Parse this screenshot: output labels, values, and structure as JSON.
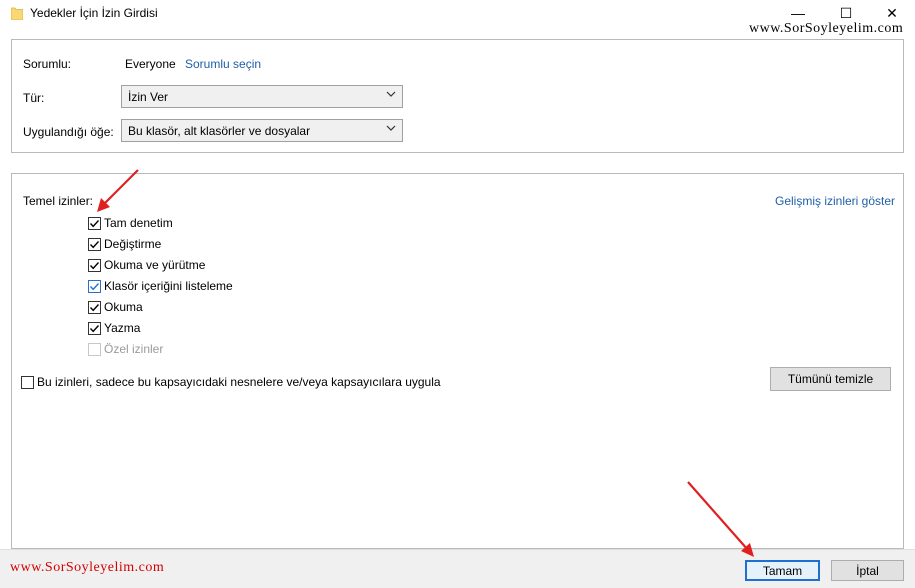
{
  "window": {
    "title": "Yedekler İçin İzin Girdisi",
    "controls": {
      "minimize": "—",
      "maximize": "☐",
      "close": "✕"
    }
  },
  "watermark": {
    "top": "www.SorSoyleyelim.com",
    "bottom": "www.SorSoyleyelim.com"
  },
  "principal": {
    "label": "Sorumlu:",
    "value": "Everyone",
    "select_link": "Sorumlu seçin"
  },
  "type": {
    "label": "Tür:",
    "value": "İzin Ver"
  },
  "applies_to": {
    "label": "Uygulandığı öğe:",
    "value": "Bu klasör, alt klasörler ve dosyalar"
  },
  "basic_permissions": {
    "label": "Temel izinler:",
    "show_advanced_link": "Gelişmiş izinleri göster",
    "items": [
      {
        "label": "Tam denetim",
        "checked": true,
        "disabled": false
      },
      {
        "label": "Değiştirme",
        "checked": true,
        "disabled": false
      },
      {
        "label": "Okuma ve yürütme",
        "checked": true,
        "disabled": false
      },
      {
        "label": "Klasör içeriğini listeleme",
        "checked": true,
        "disabled": false
      },
      {
        "label": "Okuma",
        "checked": true,
        "disabled": false
      },
      {
        "label": "Yazma",
        "checked": true,
        "disabled": false
      },
      {
        "label": "Özel izinler",
        "checked": false,
        "disabled": true
      }
    ],
    "apply_only_label": "Bu izinleri, sadece bu kapsayıcıdaki nesnelere ve/veya kapsayıcılara uygula",
    "apply_only_checked": false,
    "clear_all_button": "Tümünü temizle"
  },
  "footer": {
    "ok_button": "Tamam",
    "cancel_button": "İptal"
  },
  "colors": {
    "link": "#1f5fa8",
    "arrow": "#e02020",
    "watermark_bottom": "#d20000"
  }
}
